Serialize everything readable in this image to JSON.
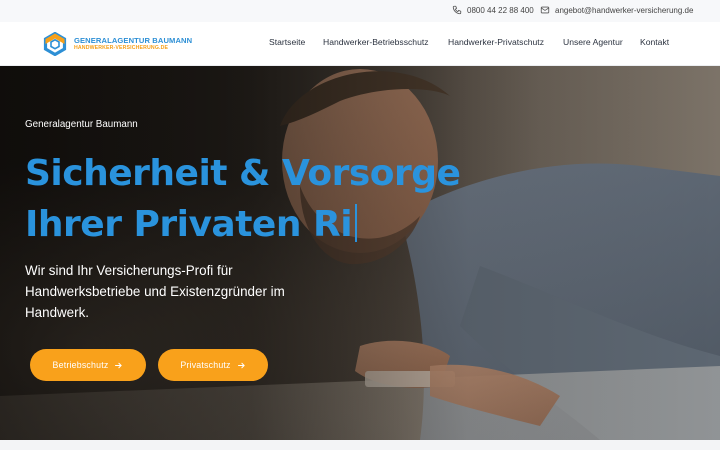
{
  "topbar": {
    "phone": "0800 44 22 88 400",
    "email": "angebot@handwerker-versicherung.de",
    "phone_icon": "phone-icon",
    "email_icon": "mail-icon"
  },
  "header": {
    "logo": {
      "name": "GENERALAGENTUR BAUMANN",
      "domain": "HANDWERKER-VERSICHERUNG.DE",
      "mark_icon": "hexagon-logo-icon"
    },
    "nav": [
      {
        "label": "Startseite"
      },
      {
        "label": "Handwerker-Betriebsschutz"
      },
      {
        "label": "Handwerker-Privatschutz"
      },
      {
        "label": "Unsere Agentur"
      },
      {
        "label": "Kontakt"
      }
    ]
  },
  "hero": {
    "eyebrow": "Generalagentur Baumann",
    "headline_line1": "Sicherheit & Vorsorge",
    "headline_line2": "Ihrer Privaten Ri",
    "lead": "Wir sind Ihr Versicherungs-Profi für Handwerksbetriebe und Existenzgründer im Handwerk.",
    "buttons": [
      {
        "label": "Betriebschutz",
        "icon": "arrow-right-icon"
      },
      {
        "label": "Privatschutz",
        "icon": "arrow-right-icon"
      }
    ]
  },
  "colors": {
    "brand_blue": "#2a93dd",
    "accent_orange": "#f9a11b",
    "nav_text": "#2c3340"
  }
}
